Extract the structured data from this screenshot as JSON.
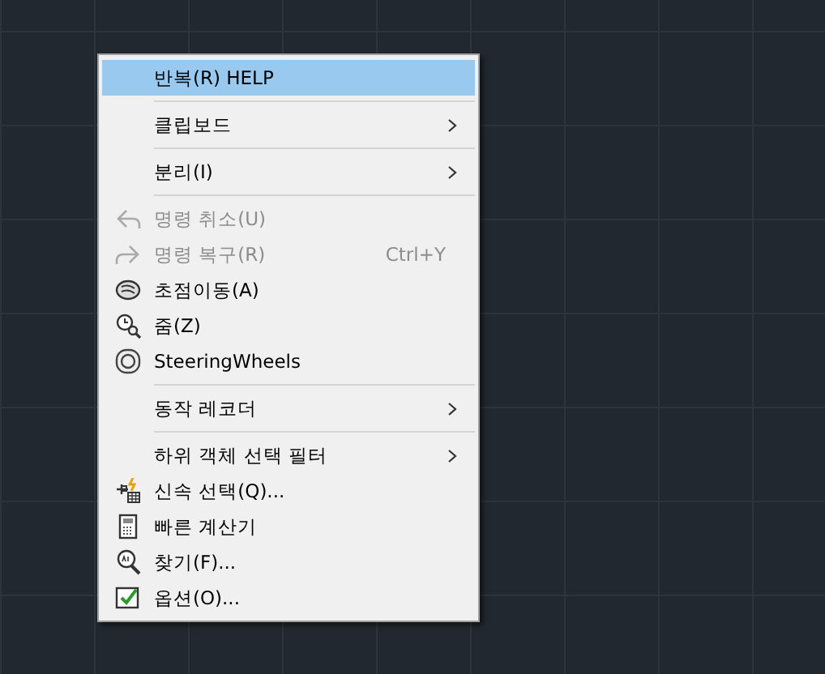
{
  "context_menu": {
    "items": [
      {
        "kind": "command",
        "label": "반복(R) HELP",
        "selected": true,
        "disabled": false,
        "submenu": false
      },
      {
        "kind": "separator"
      },
      {
        "kind": "command",
        "label": "클립보드",
        "selected": false,
        "disabled": false,
        "submenu": true
      },
      {
        "kind": "separator"
      },
      {
        "kind": "command",
        "label": "분리(I)",
        "selected": false,
        "disabled": false,
        "submenu": true
      },
      {
        "kind": "separator"
      },
      {
        "kind": "command",
        "label": "명령 취소(U)",
        "selected": false,
        "disabled": true,
        "submenu": false
      },
      {
        "kind": "command",
        "label": "명령 복구(R)",
        "shortcut": "Ctrl+Y",
        "selected": false,
        "disabled": true,
        "submenu": false
      },
      {
        "kind": "command",
        "label": "초점이동(A)",
        "selected": false,
        "disabled": false,
        "submenu": false
      },
      {
        "kind": "command",
        "label": "줌(Z)",
        "selected": false,
        "disabled": false,
        "submenu": false
      },
      {
        "kind": "command",
        "label": "SteeringWheels",
        "selected": false,
        "disabled": false,
        "submenu": false
      },
      {
        "kind": "separator"
      },
      {
        "kind": "command",
        "label": "동작 레코더",
        "selected": false,
        "disabled": false,
        "submenu": true
      },
      {
        "kind": "separator"
      },
      {
        "kind": "command",
        "label": "하위 객체 선택 필터",
        "selected": false,
        "disabled": false,
        "submenu": true
      },
      {
        "kind": "command",
        "label": "신속 선택(Q)...",
        "selected": false,
        "disabled": false,
        "submenu": false
      },
      {
        "kind": "command",
        "label": "빠른 계산기",
        "selected": false,
        "disabled": false,
        "submenu": false
      },
      {
        "kind": "command",
        "label": "찾기(F)...",
        "selected": false,
        "disabled": false,
        "submenu": false
      },
      {
        "kind": "command",
        "label": "옵션(O)...",
        "selected": false,
        "disabled": false,
        "submenu": false
      }
    ]
  }
}
